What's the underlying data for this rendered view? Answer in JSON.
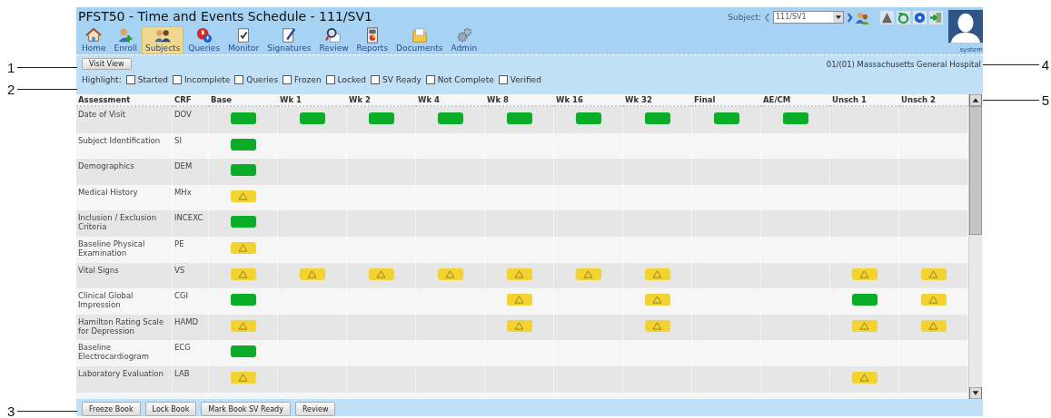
{
  "window": {
    "title": "PFST50 - Time and Events Schedule - 111/SV1"
  },
  "toolbar": [
    {
      "label": "Home",
      "kind": "home",
      "selected": false
    },
    {
      "label": "Enroll",
      "kind": "enroll",
      "selected": false
    },
    {
      "label": "Subjects",
      "kind": "subjects",
      "selected": true
    },
    {
      "label": "Queries",
      "kind": "queries",
      "selected": false
    },
    {
      "label": "Monitor",
      "kind": "monitor",
      "selected": false
    },
    {
      "label": "Signatures",
      "kind": "signatures",
      "selected": false
    },
    {
      "label": "Review",
      "kind": "review",
      "selected": false
    },
    {
      "label": "Reports",
      "kind": "reports",
      "selected": false
    },
    {
      "label": "Documents",
      "kind": "documents",
      "selected": false
    },
    {
      "label": "Admin",
      "kind": "admin",
      "selected": false
    }
  ],
  "subject": {
    "label": "Subject:",
    "value": "111/SV1"
  },
  "user": {
    "name": "system"
  },
  "visit_view_button": "Visit View",
  "site": "01/(01) Massachusetts General Hospital",
  "highlight": {
    "label": "Highlight:",
    "options": [
      {
        "label": "Started",
        "checked": false
      },
      {
        "label": "Incomplete",
        "checked": false
      },
      {
        "label": "Queries",
        "checked": false
      },
      {
        "label": "Frozen",
        "checked": false
      },
      {
        "label": "Locked",
        "checked": false
      },
      {
        "label": "SV Ready",
        "checked": false
      },
      {
        "label": "Not Complete",
        "checked": false
      },
      {
        "label": "Verified",
        "checked": false
      }
    ]
  },
  "table": {
    "columns": [
      "Assessment",
      "CRF",
      "Base",
      "Wk 1",
      "Wk 2",
      "Wk 4",
      "Wk 8",
      "Wk 16",
      "Wk 32",
      "Final",
      "AE/CM",
      "Unsch 1",
      "Unsch 2"
    ],
    "rows": [
      {
        "assessment": "Date of Visit",
        "crf": "DOV",
        "cells": [
          {
            "kind": "complete"
          },
          {
            "kind": "complete"
          },
          {
            "kind": "complete"
          },
          {
            "kind": "complete"
          },
          {
            "kind": "complete"
          },
          {
            "kind": "complete"
          },
          {
            "kind": "complete"
          },
          {
            "kind": "complete"
          },
          {
            "kind": "complete"
          },
          null,
          null
        ]
      },
      {
        "assessment": "Subject Identification",
        "crf": "SI",
        "cells": [
          {
            "kind": "complete"
          },
          null,
          null,
          null,
          null,
          null,
          null,
          null,
          null,
          null,
          null
        ]
      },
      {
        "assessment": "Demographics",
        "crf": "DEM",
        "cells": [
          {
            "kind": "complete"
          },
          null,
          null,
          null,
          null,
          null,
          null,
          null,
          null,
          null,
          null
        ]
      },
      {
        "assessment": "Medical History",
        "crf": "MHx",
        "cells": [
          {
            "kind": "warning"
          },
          null,
          null,
          null,
          null,
          null,
          null,
          null,
          null,
          null,
          null
        ]
      },
      {
        "assessment": "Inclusion / Exclusion Criteria",
        "crf": "INCEXC",
        "cells": [
          {
            "kind": "complete"
          },
          null,
          null,
          null,
          null,
          null,
          null,
          null,
          null,
          null,
          null
        ]
      },
      {
        "assessment": "Baseline Physical Examination",
        "crf": "PE",
        "cells": [
          {
            "kind": "warning"
          },
          null,
          null,
          null,
          null,
          null,
          null,
          null,
          null,
          null,
          null
        ]
      },
      {
        "assessment": "Vital Signs",
        "crf": "VS",
        "cells": [
          {
            "kind": "warning"
          },
          {
            "kind": "warning"
          },
          {
            "kind": "warning"
          },
          {
            "kind": "warning"
          },
          {
            "kind": "warning"
          },
          {
            "kind": "warning"
          },
          {
            "kind": "warning"
          },
          null,
          null,
          {
            "kind": "warning"
          },
          {
            "kind": "warning"
          }
        ]
      },
      {
        "assessment": "Clinical Global Impression",
        "crf": "CGI",
        "cells": [
          {
            "kind": "complete"
          },
          null,
          null,
          null,
          {
            "kind": "warning"
          },
          null,
          {
            "kind": "warning"
          },
          null,
          null,
          {
            "kind": "complete"
          },
          {
            "kind": "warning"
          }
        ]
      },
      {
        "assessment": "Hamilton Rating Scale for Depression",
        "crf": "HAMD",
        "cells": [
          {
            "kind": "warning"
          },
          null,
          null,
          null,
          {
            "kind": "warning"
          },
          null,
          {
            "kind": "warning"
          },
          null,
          null,
          {
            "kind": "warning"
          },
          {
            "kind": "warning"
          }
        ]
      },
      {
        "assessment": "Baseline Electrocardiogram",
        "crf": "ECG",
        "cells": [
          {
            "kind": "complete"
          },
          null,
          null,
          null,
          null,
          null,
          null,
          null,
          null,
          null,
          null
        ]
      },
      {
        "assessment": "Laboratory Evaluation",
        "crf": "LAB",
        "cells": [
          {
            "kind": "warning"
          },
          null,
          null,
          null,
          null,
          null,
          null,
          null,
          null,
          {
            "kind": "warning"
          },
          null
        ]
      }
    ]
  },
  "footer_buttons": [
    "Freeze Book",
    "Lock Book",
    "Mark Book SV Ready",
    "Review"
  ],
  "callouts": [
    {
      "label": "1",
      "kind": "left"
    },
    {
      "label": "2",
      "kind": "left"
    },
    {
      "label": "3",
      "kind": "left"
    },
    {
      "label": "4",
      "kind": "right"
    },
    {
      "label": "5",
      "kind": "right"
    }
  ]
}
